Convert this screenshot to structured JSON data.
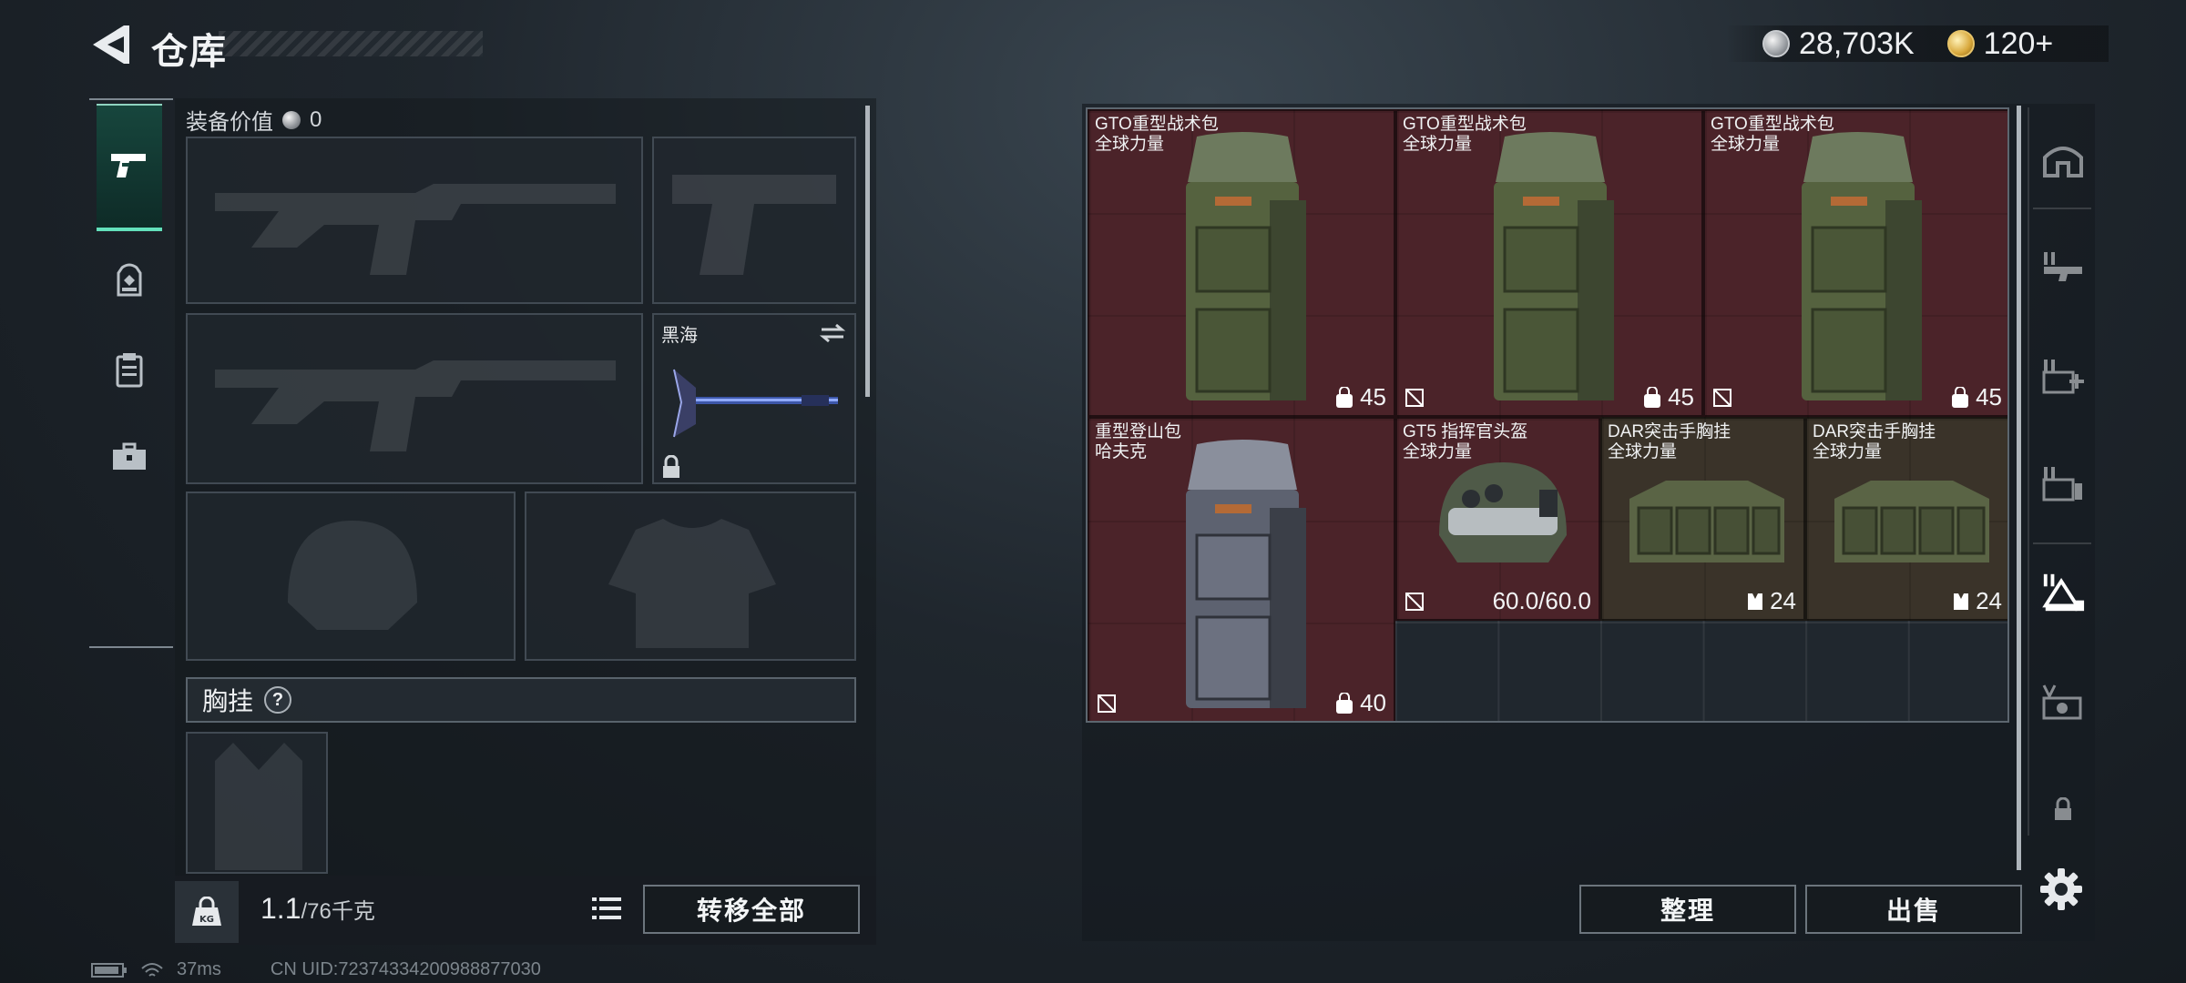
{
  "header": {
    "title": "仓库",
    "currency": [
      {
        "name": "silver-coin",
        "value": "28,703K"
      },
      {
        "name": "gold-coin",
        "value": "120+"
      }
    ]
  },
  "left_rail": {
    "tabs": [
      {
        "name": "pistol-icon",
        "active": true
      },
      {
        "name": "backpack-icon",
        "active": false
      },
      {
        "name": "clipboard-icon",
        "active": false
      },
      {
        "name": "toolbox-icon",
        "active": false
      }
    ]
  },
  "equipment": {
    "value_label": "装备价值",
    "value_amount": "0",
    "melee_name": "黑海",
    "rig_label": "胸挂",
    "help_mark": "?"
  },
  "footer": {
    "weight_current": "1.1",
    "weight_max": "/76千克",
    "kg_badge": "KG",
    "transfer_all": "转移全部",
    "organize": "整理",
    "sell": "出售"
  },
  "status": {
    "ping": "37ms",
    "uid": "CN UID:72374334200988877030"
  },
  "stash_items": [
    {
      "name": "GTO重型战术包",
      "sub": "全球力量",
      "value": "45",
      "kind": "backpack",
      "flag": false
    },
    {
      "name": "GTO重型战术包",
      "sub": "全球力量",
      "value": "45",
      "kind": "backpack",
      "flag": true
    },
    {
      "name": "GTO重型战术包",
      "sub": "全球力量",
      "value": "45",
      "kind": "backpack",
      "flag": true
    },
    {
      "name": "重型登山包",
      "sub": "哈夫克",
      "value": "40",
      "kind": "backpack-gray",
      "flag": true
    },
    {
      "name": "GT5 指挥官头盔",
      "sub": "全球力量",
      "value": "60.0/60.0",
      "kind": "helmet",
      "flag": true
    },
    {
      "name": "DAR突击手胸挂",
      "sub": "全球力量",
      "value": "24",
      "kind": "rig",
      "flag": false
    },
    {
      "name": "DAR突击手胸挂",
      "sub": "全球力量",
      "value": "24",
      "kind": "rig",
      "flag": false
    }
  ]
}
